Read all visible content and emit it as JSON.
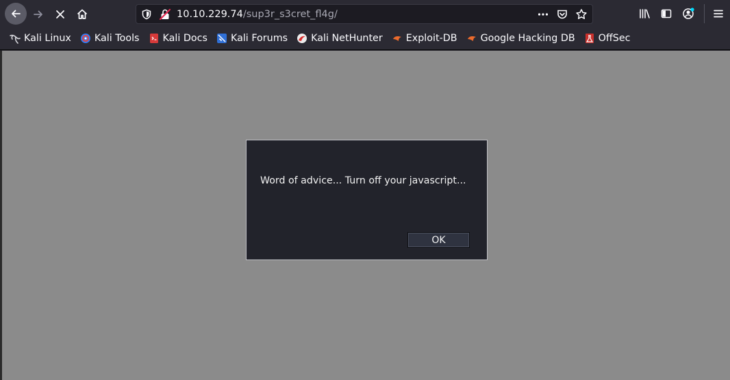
{
  "browser": {
    "url_host": "10.10.229.74",
    "url_path": "/sup3r_s3cret_fl4g/"
  },
  "bookmarks": [
    {
      "label": "Kali Linux",
      "icon": "kali-dragon-icon"
    },
    {
      "label": "Kali Tools",
      "icon": "kali-tools-icon"
    },
    {
      "label": "Kali Docs",
      "icon": "kali-docs-icon"
    },
    {
      "label": "Kali Forums",
      "icon": "kali-forums-icon"
    },
    {
      "label": "Kali NetHunter",
      "icon": "kali-nethunter-icon"
    },
    {
      "label": "Exploit-DB",
      "icon": "exploit-db-icon"
    },
    {
      "label": "Google Hacking DB",
      "icon": "google-hacking-db-icon"
    },
    {
      "label": "OffSec",
      "icon": "offsec-icon"
    }
  ],
  "dialog": {
    "message": "Word of advice... Turn off your javascript...",
    "ok_label": "OK"
  },
  "colors": {
    "toolbar": "#2b2a33",
    "page_background": "#8b8b8b",
    "dialog_background": "#22232b"
  }
}
